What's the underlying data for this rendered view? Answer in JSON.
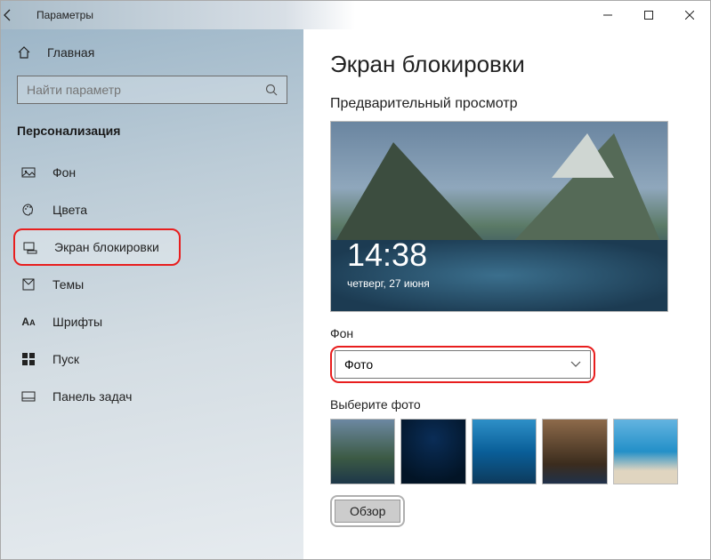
{
  "window": {
    "title": "Параметры"
  },
  "sidebar": {
    "home": "Главная",
    "search_placeholder": "Найти параметр",
    "category": "Персонализация",
    "items": [
      {
        "label": "Фон"
      },
      {
        "label": "Цвета"
      },
      {
        "label": "Экран блокировки"
      },
      {
        "label": "Темы"
      },
      {
        "label": "Шрифты"
      },
      {
        "label": "Пуск"
      },
      {
        "label": "Панель задач"
      }
    ]
  },
  "main": {
    "heading": "Экран блокировки",
    "preview_label": "Предварительный просмотр",
    "preview": {
      "time": "14:38",
      "date": "четверг, 27 июня"
    },
    "background_label": "Фон",
    "background_value": "Фото",
    "choose_photo_label": "Выберите фото",
    "browse_label": "Обзор"
  }
}
